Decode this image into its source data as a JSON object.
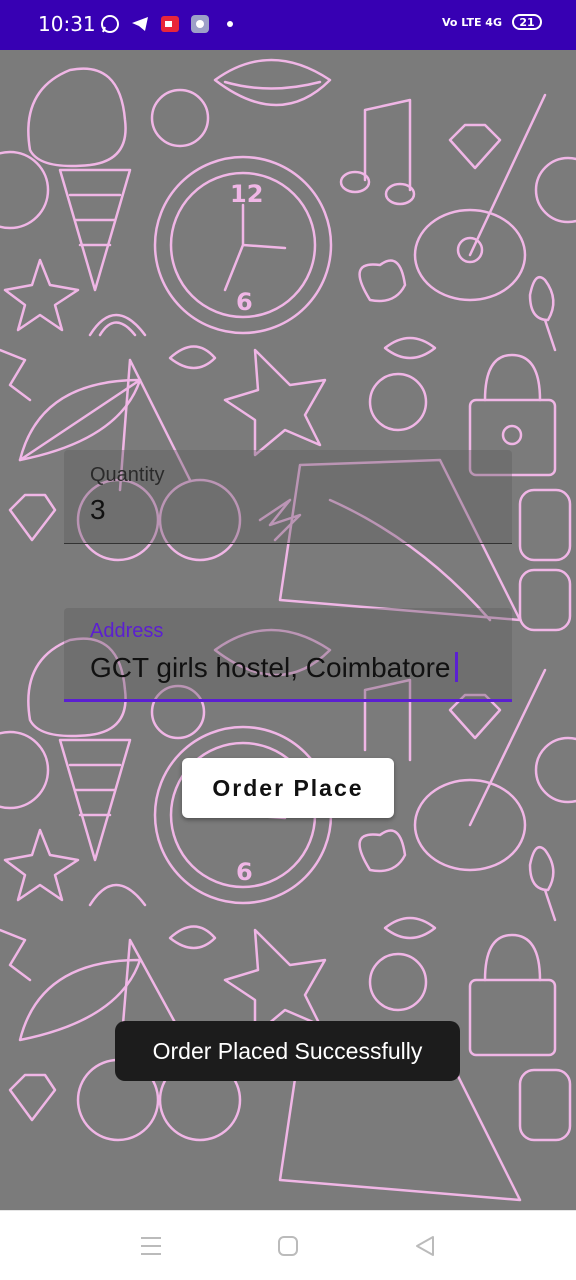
{
  "status_bar": {
    "time": "10:31",
    "left_icons": [
      "whatsapp-icon",
      "telegram-icon",
      "screen-record-icon",
      "app-icon",
      "dot-icon"
    ],
    "network": "Vo LTE 4G",
    "battery": "21"
  },
  "form": {
    "quantity": {
      "label": "Quantity",
      "value": "3"
    },
    "address": {
      "label": "Address",
      "value": "GCT girls hostel, Coimbatore"
    },
    "submit_label": "Order Place"
  },
  "toast": {
    "message": "Order Placed Successfully"
  },
  "nav": {
    "items": [
      "menu-icon",
      "home-icon",
      "back-icon"
    ]
  },
  "colors": {
    "accent": "#5b1fd1",
    "status_bar": "#3700b3",
    "doodle": "#f0b6e6",
    "background": "#7b7b7b"
  }
}
